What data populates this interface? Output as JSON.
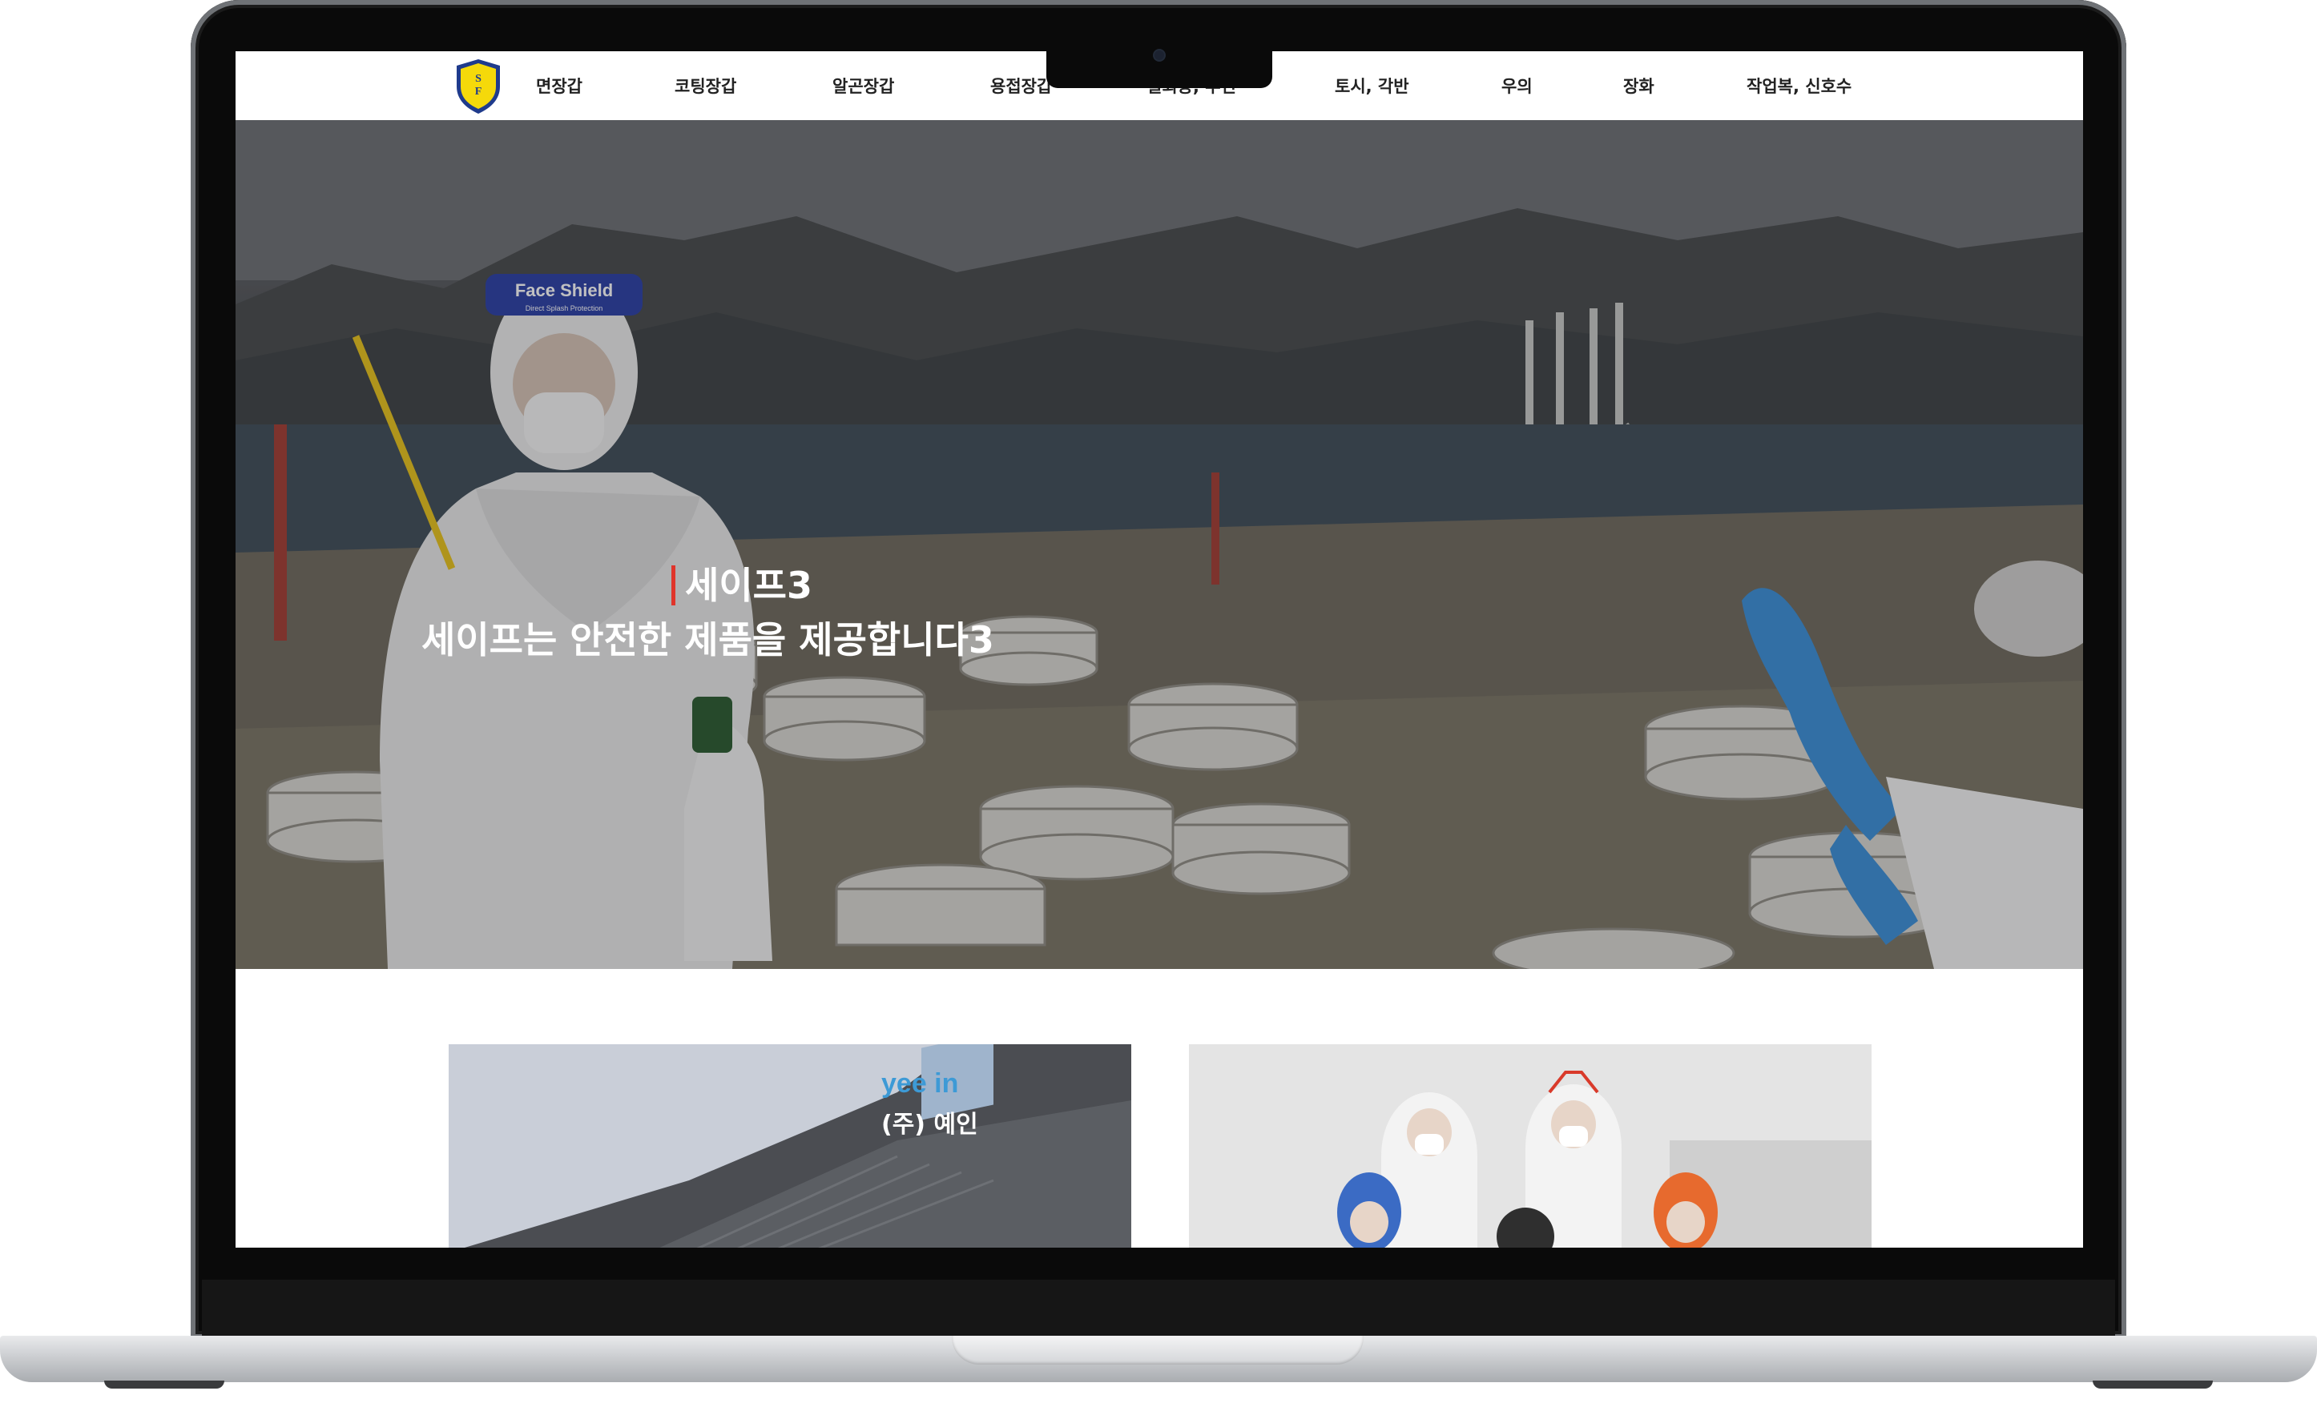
{
  "nav": {
    "items": [
      {
        "label": "면장갑"
      },
      {
        "label": "코팅장갑"
      },
      {
        "label": "알곤장갑"
      },
      {
        "label": "용접장갑"
      },
      {
        "label": "일회용, 투인"
      },
      {
        "label": "토시, 각반"
      },
      {
        "label": "우의"
      },
      {
        "label": "장화"
      },
      {
        "label": "작업복, 신호수"
      }
    ],
    "logo_text": "SF"
  },
  "hero": {
    "title": "세이프3",
    "subtitle": "세이프는 안전한 제품을 제공합니다3",
    "shield_label": "Face Shield",
    "shield_sub": "Direct Splash Protection",
    "progress_fraction": 0.55,
    "active_slide": 1
  },
  "cards": {
    "left_sign_en": "yee in",
    "left_sign_ko": "(주) 예인"
  },
  "colors": {
    "accent": "#e0342b",
    "nav_text": "#222222",
    "logo_yellow": "#f5d90a",
    "logo_blue": "#1f3b8c"
  }
}
